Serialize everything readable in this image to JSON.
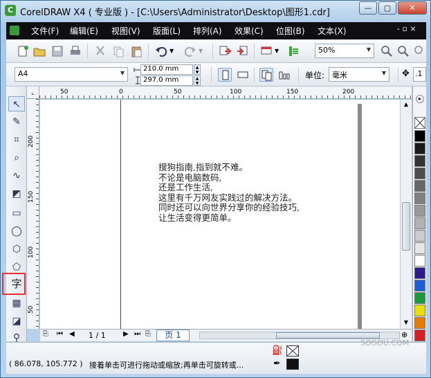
{
  "window": {
    "title": "CorelDRAW X4 ( 专业版 ) - [C:\\Users\\Administrator\\Desktop\\图形1.cdr]",
    "minimize_glyph": "—",
    "restore_glyph": "▢",
    "close_glyph": "✕"
  },
  "menu": {
    "items": [
      "文件(F)",
      "编辑(E)",
      "视图(V)",
      "版面(L)",
      "排列(A)",
      "效果(C)",
      "位图(B)",
      "文本(X)"
    ],
    "doc_controls": "- ▫ ×"
  },
  "standard_toolbar": {
    "zoom_value": "50%"
  },
  "property_bar": {
    "paper_size": "A4",
    "width": "210.0 mm",
    "height": "297.0 mm",
    "units_label": "单位:",
    "units_value": "毫米",
    "nudge_value": ".1"
  },
  "ruler": {
    "horizontal_labels": [
      "50",
      "0",
      "50",
      "100",
      "150",
      "200"
    ],
    "vertical_labels": [
      "200",
      "150",
      "100",
      "50"
    ]
  },
  "toolbox": {
    "text_tool_glyph": "字"
  },
  "document": {
    "text_lines": [
      "搜狗指南,指到就不难。",
      "不论是电脑数码,",
      "还是工作生活,",
      "这里有千万网友实践过的解决方法。",
      "同时还可以向世界分享你的经验技巧,",
      "让生活变得更简单。"
    ]
  },
  "page_navigator": {
    "page_count": "1 / 1",
    "page_tab": "页 1"
  },
  "status": {
    "coordinates": "( 86.078, 105.772 )",
    "hint": "接着单击可进行拖动或缩放;再单击可旋转或..."
  },
  "watermark": "SOGOU.COM",
  "colors": {
    "menubar_bg": "#0f0f12",
    "highlight_red": "#e83030",
    "arrow_red": "#e83030",
    "palette": [
      "#000000",
      "#1a1a1a",
      "#333333",
      "#4d4d4d",
      "#666666",
      "#808080",
      "#999999",
      "#b3b3b3",
      "#cccccc",
      "#e6e6e6",
      "#ffffff",
      "#2e1a8a",
      "#1f5fd6",
      "#1a9a3a",
      "#e8e000",
      "#e87a00",
      "#d81f1f"
    ]
  }
}
